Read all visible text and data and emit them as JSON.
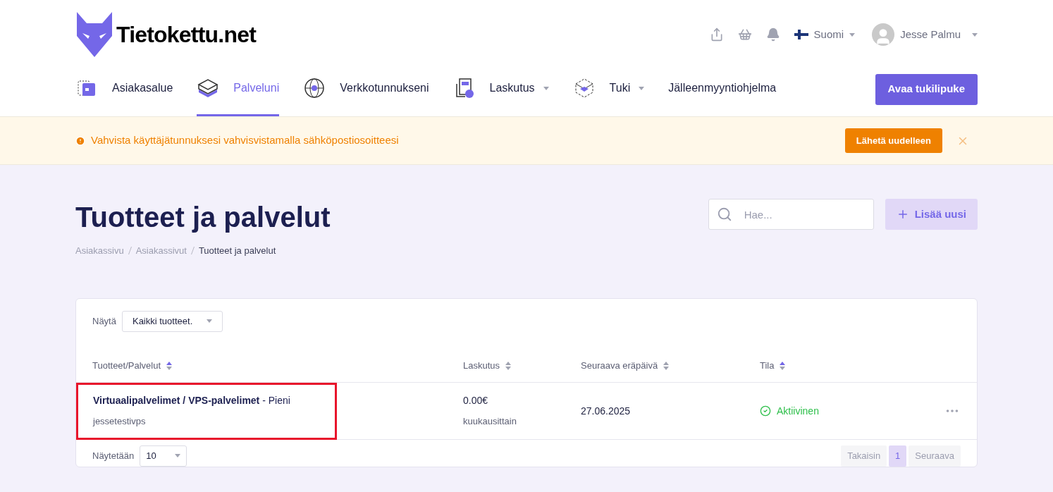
{
  "brand": {
    "name": "Tietokettu.net"
  },
  "topbar": {
    "language": "Suomi",
    "user": "Jesse Palmu"
  },
  "nav": [
    {
      "label": "Asiakasalue",
      "selected": false,
      "dropdown": false
    },
    {
      "label": "Palveluni",
      "selected": true,
      "dropdown": false
    },
    {
      "label": "Verkkotunnukseni",
      "selected": false,
      "dropdown": false
    },
    {
      "label": "Laskutus",
      "selected": false,
      "dropdown": true
    },
    {
      "label": "Tuki",
      "selected": false,
      "dropdown": true
    },
    {
      "label": "Jälleenmyyntiohjelma",
      "selected": false,
      "dropdown": false
    }
  ],
  "nav_button": "Avaa tukilipuke",
  "alert": {
    "message": "Vahvista käyttäjätunnuksesi vahvisvistamalla sähköpostiosoitteesi",
    "button": "Lähetä uudelleen"
  },
  "page": {
    "title": "Tuotteet ja palvelut",
    "search_placeholder": "Hae...",
    "add_button": "Lisää uusi"
  },
  "breadcrumb": [
    {
      "label": "Asiakassivu",
      "selected": false
    },
    {
      "label": "Asiakassivut",
      "selected": false
    },
    {
      "label": "Tuotteet ja palvelut",
      "selected": true
    }
  ],
  "table": {
    "filter_label": "Näytä",
    "filter_value": "Kaikki tuotteet.",
    "columns": [
      {
        "label": "Tuotteet/Palvelut",
        "sorted": true
      },
      {
        "label": "Laskutus",
        "sorted": false
      },
      {
        "label": "Seuraava eräpäivä",
        "sorted": false
      },
      {
        "label": "Tila",
        "sorted": true
      }
    ],
    "rows": [
      {
        "product": "**Virtuaalipalvelimet / VPS-palvelimet** - Pieni",
        "hostname": "jessetestivps",
        "price": "0.00€",
        "cycle": "kuukausittain",
        "due": "27.06.2025",
        "status": "Aktiivinen",
        "highlighted": true
      }
    ],
    "page_size_label": "Näytetään",
    "page_size": "10",
    "pagination": [
      {
        "label": "Takaisin",
        "selected": false
      },
      {
        "label": "1",
        "selected": true
      },
      {
        "label": "Seuraava",
        "selected": false
      }
    ]
  }
}
